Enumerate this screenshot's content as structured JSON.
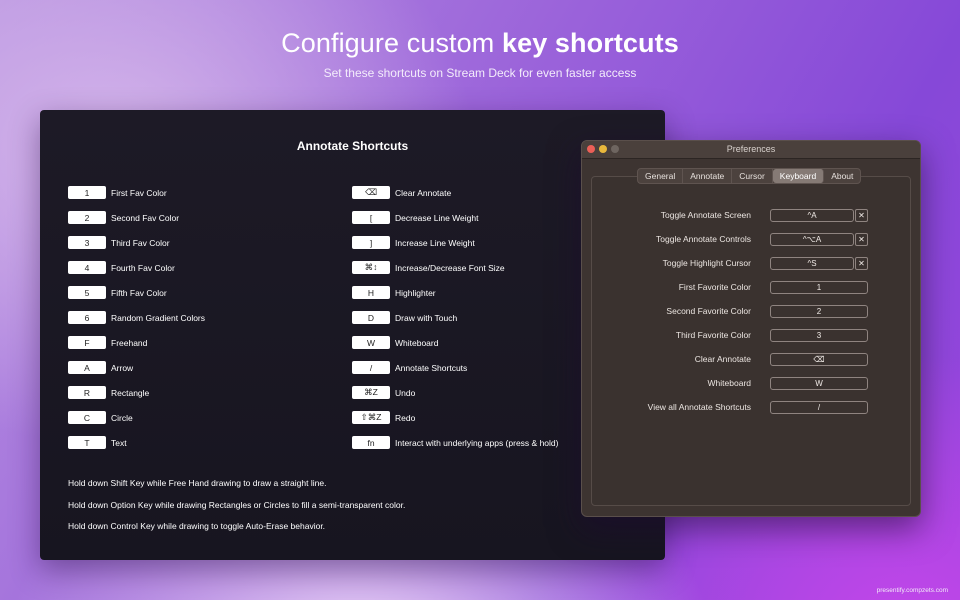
{
  "headline": {
    "title_regular": "Configure custom ",
    "title_bold": "key shortcuts",
    "subtitle": "Set these shortcuts on Stream Deck for even faster access"
  },
  "shortcuts_panel": {
    "title": "Annotate Shortcuts",
    "left": [
      {
        "key": "1",
        "label": "First Fav Color"
      },
      {
        "key": "2",
        "label": "Second Fav Color"
      },
      {
        "key": "3",
        "label": "Third Fav Color"
      },
      {
        "key": "4",
        "label": "Fourth Fav Color"
      },
      {
        "key": "5",
        "label": "Fifth Fav Color"
      },
      {
        "key": "6",
        "label": "Random Gradient Colors"
      },
      {
        "key": "F",
        "label": "Freehand"
      },
      {
        "key": "A",
        "label": "Arrow"
      },
      {
        "key": "R",
        "label": "Rectangle"
      },
      {
        "key": "C",
        "label": "Circle"
      },
      {
        "key": "T",
        "label": "Text"
      }
    ],
    "right": [
      {
        "key": "⌫",
        "label": "Clear Annotate"
      },
      {
        "key": "[",
        "label": "Decrease Line Weight"
      },
      {
        "key": "]",
        "label": "Increase Line Weight"
      },
      {
        "key": "⌘↕",
        "label": "Increase/Decrease Font Size"
      },
      {
        "key": "H",
        "label": "Highlighter"
      },
      {
        "key": "D",
        "label": "Draw with Touch"
      },
      {
        "key": "W",
        "label": "Whiteboard"
      },
      {
        "key": "/",
        "label": "Annotate Shortcuts"
      },
      {
        "key": "⌘Z",
        "label": "Undo"
      },
      {
        "key": "⇧⌘Z",
        "label": "Redo"
      },
      {
        "key": "fn",
        "label": "Interact with underlying apps (press & hold)"
      }
    ],
    "notes": [
      "Hold down Shift Key while Free Hand drawing to draw a straight line.",
      "Hold down Option Key while drawing Rectangles or Circles to fill a semi-transparent color.",
      "Hold down Control Key while drawing to toggle Auto-Erase behavior."
    ]
  },
  "preferences": {
    "window_title": "Preferences",
    "tabs": [
      "General",
      "Annotate",
      "Cursor",
      "Keyboard",
      "About"
    ],
    "active_tab": "Keyboard",
    "rows": [
      {
        "label": "Toggle Annotate Screen",
        "value": "^A",
        "clearable": true
      },
      {
        "label": "Toggle Annotate Controls",
        "value": "^⌥A",
        "clearable": true
      },
      {
        "label": "Toggle Highlight Cursor",
        "value": "^S",
        "clearable": true
      },
      {
        "label": "First Favorite Color",
        "value": "1",
        "clearable": false
      },
      {
        "label": "Second Favorite Color",
        "value": "2",
        "clearable": false
      },
      {
        "label": "Third Favorite Color",
        "value": "3",
        "clearable": false
      },
      {
        "label": "Clear Annotate",
        "value": "⌫",
        "clearable": false
      },
      {
        "label": "Whiteboard",
        "value": "W",
        "clearable": false
      },
      {
        "label": "View all Annotate Shortcuts",
        "value": "/",
        "clearable": false
      }
    ],
    "clear_glyph": "✕"
  },
  "footer": "presentify.compzets.com"
}
